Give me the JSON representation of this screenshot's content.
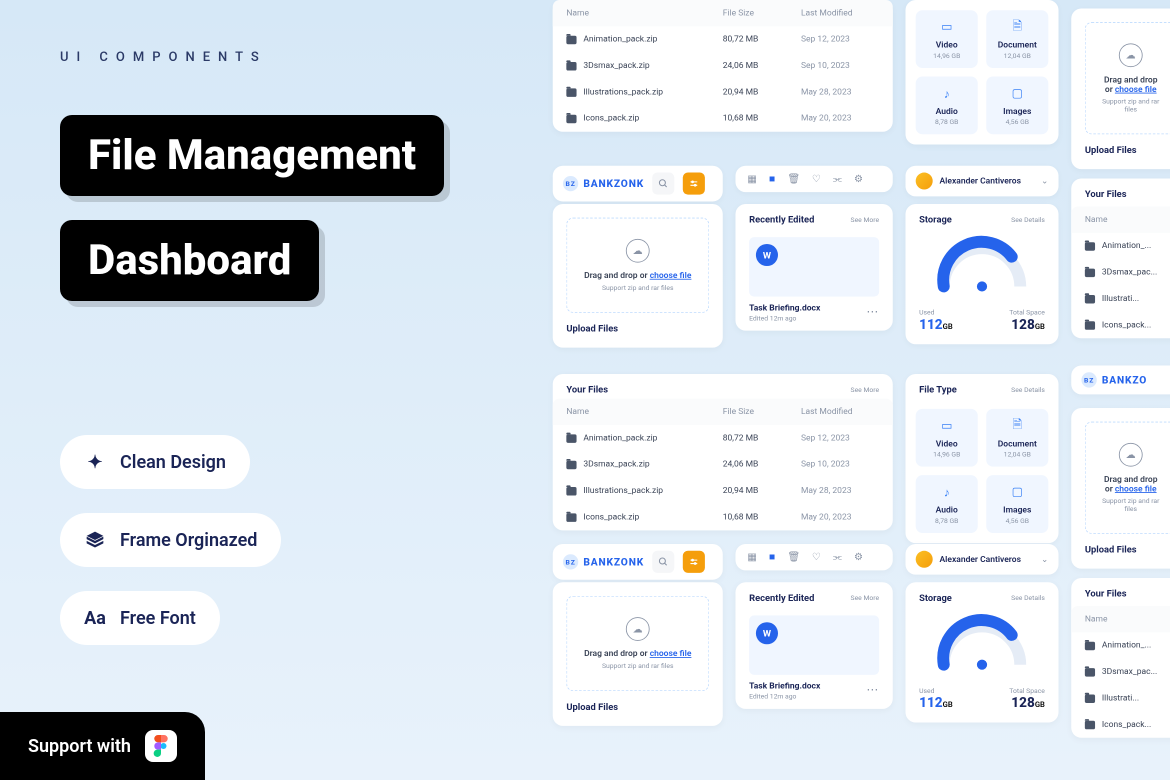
{
  "eyebrow": "UI COMPONENTS",
  "title_line1": "File Management",
  "title_line2": "Dashboard",
  "features": [
    "Clean Design",
    "Frame Orginazed",
    "Free Font"
  ],
  "support_label": "Support with",
  "logo_text": "BANKZONK",
  "logo_badge": "BZ",
  "user_name": "Alexander Cantiveros",
  "table": {
    "headers": [
      "Name",
      "File Size",
      "Last Modified"
    ],
    "rows": [
      {
        "name": "Animation_pack.zip",
        "size": "80,72 MB",
        "date": "Sep 12, 2023"
      },
      {
        "name": "3Dsmax_pack.zip",
        "size": "24,06 MB",
        "date": "Sep 10, 2023"
      },
      {
        "name": "Illustrations_pack.zip",
        "size": "20,94 MB",
        "date": "May 28, 2023"
      },
      {
        "name": "Icons_pack.zip",
        "size": "10,68 MB",
        "date": "May 20, 2023"
      }
    ]
  },
  "tiles": [
    {
      "label": "Video",
      "sub": "14,96 GB"
    },
    {
      "label": "Document",
      "sub": "12,04 GB"
    },
    {
      "label": "Audio",
      "sub": "8,78 GB"
    },
    {
      "label": "Images",
      "sub": "4,56 GB"
    }
  ],
  "upload": {
    "title": "Upload Files",
    "text_pre": "Drag and drop or ",
    "link": "choose file",
    "sub": "Support zip and rar files"
  },
  "recent": {
    "title": "Recently Edited",
    "see": "See More",
    "name": "Task Briefing.docx",
    "time": "Edited 12m ago",
    "badge": "W"
  },
  "storage": {
    "title": "Storage",
    "see": "See Details",
    "used_label": "Used",
    "used_val": "112",
    "total_label": "Total Space",
    "total_val": "128",
    "unit": "GB"
  },
  "your_files": {
    "title": "Your Files",
    "see": "See More"
  },
  "file_type": {
    "title": "File Type",
    "see": "See Details"
  }
}
